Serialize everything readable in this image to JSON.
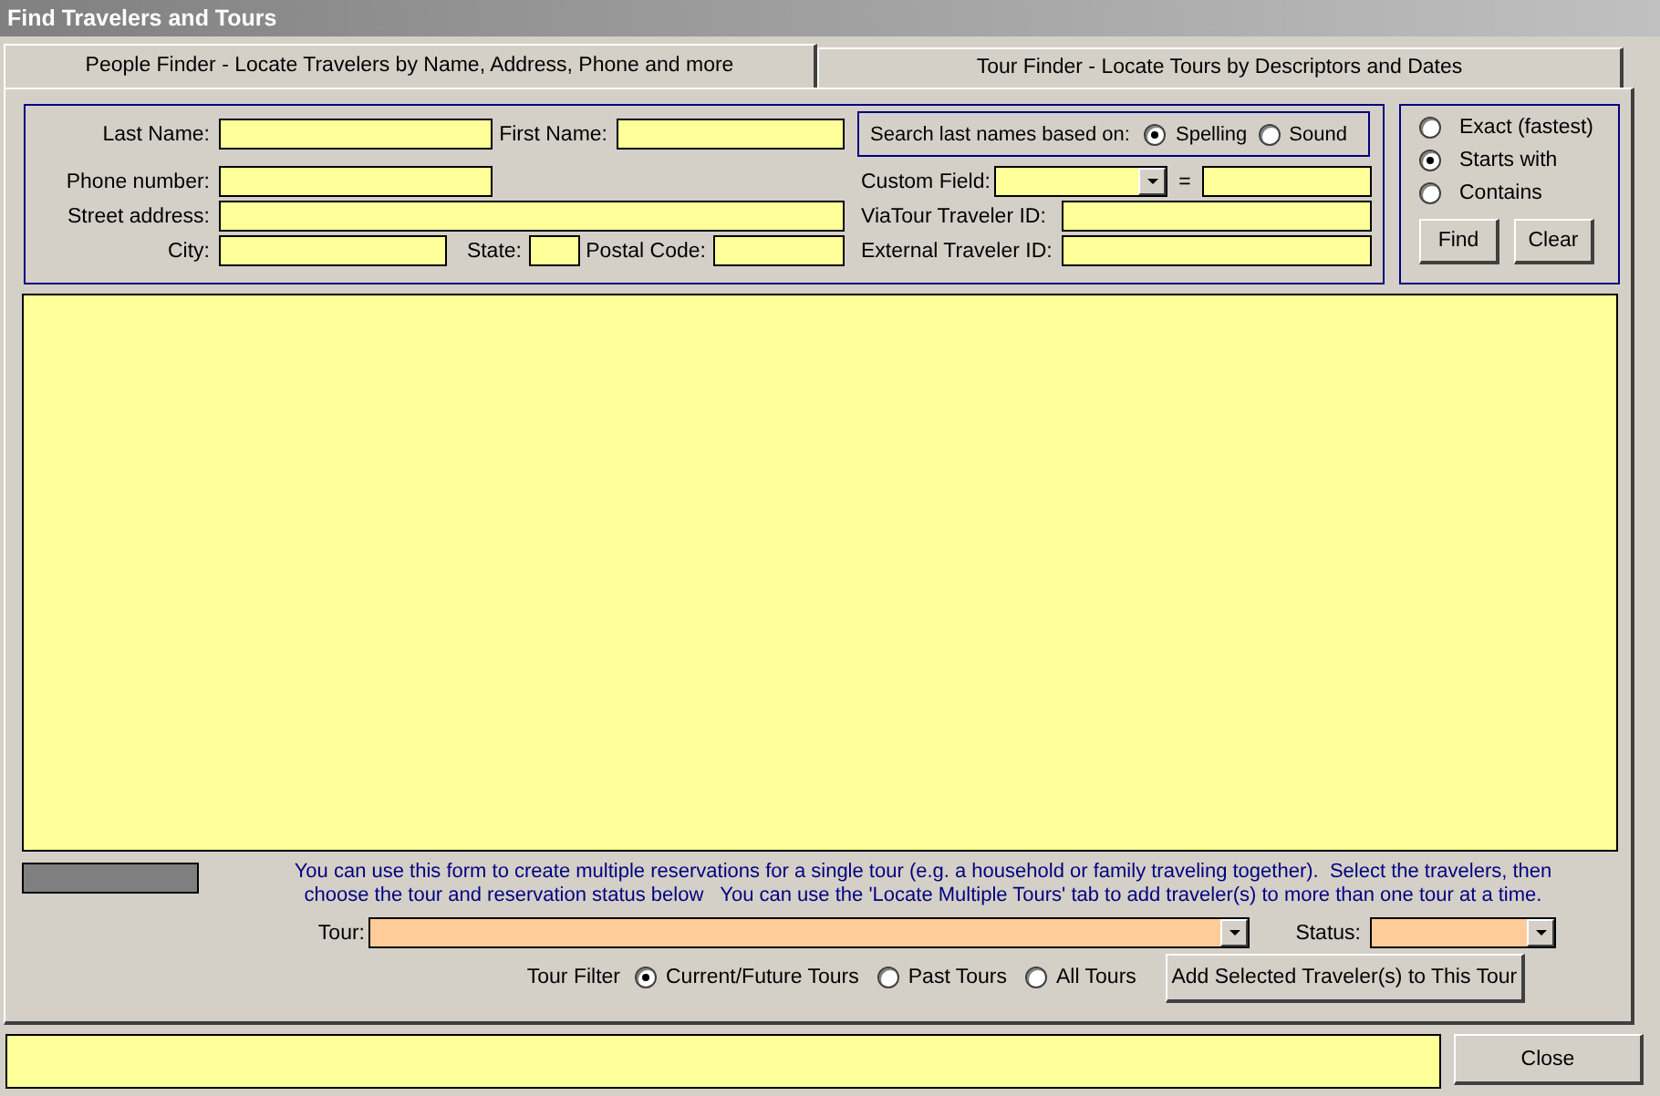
{
  "window": {
    "title": "Find Travelers and Tours"
  },
  "tabs": [
    {
      "label": "People Finder - Locate Travelers by Name, Address, Phone and more",
      "selected": true
    },
    {
      "label": "Tour Finder - Locate Tours by Descriptors and Dates",
      "selected": false
    }
  ],
  "fields": [
    {
      "label": "Last Name:"
    },
    {
      "label": "First Name:"
    },
    {
      "label": "Phone number:"
    },
    {
      "label": "Street address:"
    },
    {
      "label": "City:"
    },
    {
      "label": "State:"
    },
    {
      "label": "Postal Code:"
    },
    {
      "label": "ViaTour Traveler ID:"
    },
    {
      "label": "External Traveler ID:"
    }
  ],
  "name_match": {
    "label": "Search last names based on:",
    "options": [
      {
        "label": "Spelling",
        "selected": true
      },
      {
        "label": "Sound",
        "selected": false
      }
    ]
  },
  "custom_field": {
    "label": "Custom Field:",
    "equals": "="
  },
  "match_mode": {
    "options": [
      {
        "label": "Exact (fastest)",
        "selected": false
      },
      {
        "label": "Starts with",
        "selected": true
      },
      {
        "label": "Contains",
        "selected": false
      }
    ]
  },
  "search_buttons": [
    "Find",
    "Clear"
  ],
  "note": "You can use this form to create multiple reservations for a single tour (e.g. a household or family traveling together).  Select the travelers, then\nchoose the tour and reservation status below   You can use the 'Locate Multiple Tours' tab to add traveler(s) to more than one tour at a time.",
  "tour": {
    "label": "Tour:"
  },
  "status": {
    "label": "Status:"
  },
  "tour_filter": {
    "label": "Tour Filter",
    "options": [
      {
        "label": "Current/Future Tours",
        "selected": true
      },
      {
        "label": "Past Tours",
        "selected": false
      },
      {
        "label": "All Tours",
        "selected": false
      }
    ]
  },
  "add_button": "Add Selected Traveler(s) to This Tour",
  "close_button": "Close"
}
